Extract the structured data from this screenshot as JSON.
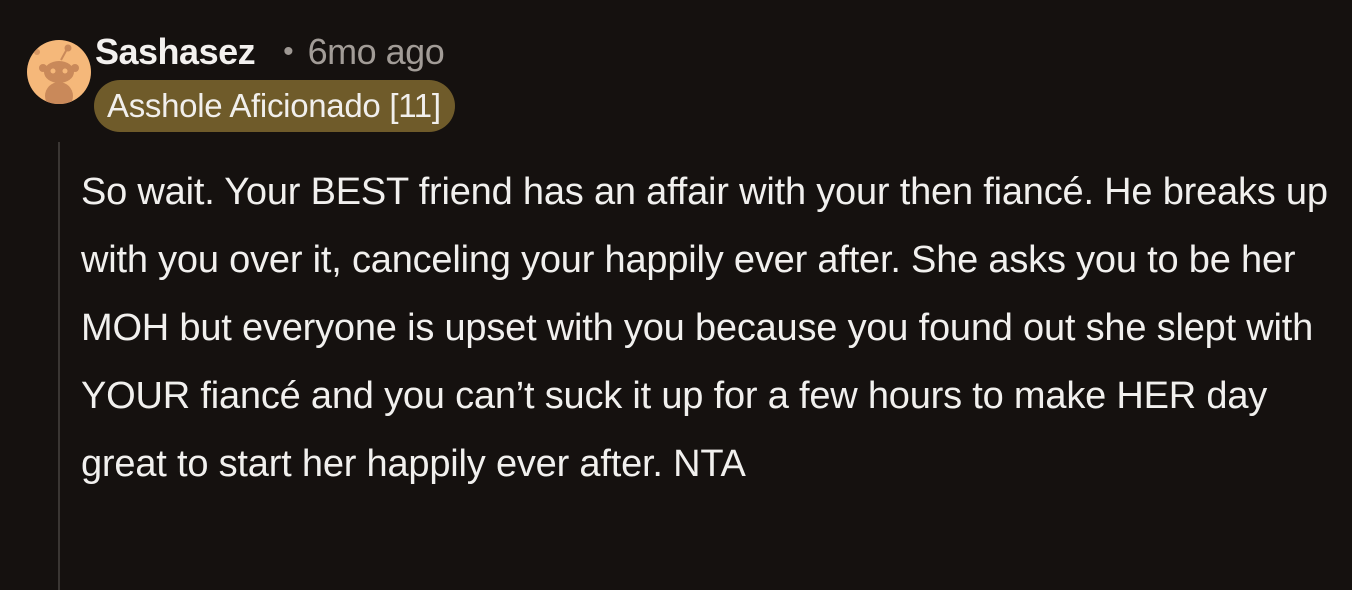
{
  "comment": {
    "author": "Sashasez",
    "separator": "•",
    "age": "6mo ago",
    "flair": "Asshole Aficionado [11]",
    "body": "So wait. Your BEST friend has an affair with your then fiancé. He breaks up with you over it, canceling your happily ever after. She asks you to be her MOH but everyone is upset with you because you found out she slept with YOUR fiancé and you can’t suck it up for a few hours to make HER day great to start her happily ever after. NTA",
    "avatar_icon": "snoo-avatar-icon"
  },
  "colors": {
    "background": "#15110f",
    "flair_background": "#6f5b2a",
    "avatar_background": "#f5b87a",
    "thread_line": "#3a3633"
  }
}
